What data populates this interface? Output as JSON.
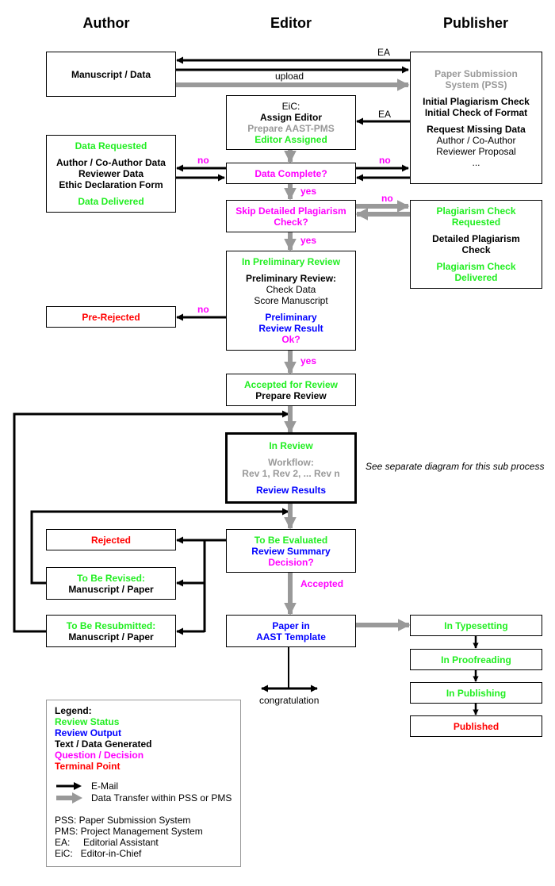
{
  "columns": {
    "author": "Author",
    "editor": "Editor",
    "publisher": "Publisher"
  },
  "colors": {
    "review_status": "#00ff00",
    "review_output": "#0000ff",
    "text_data": "#000000",
    "question": "#ff00ff",
    "terminal": "#ff0000",
    "system": "#999999",
    "email_arrow": "#000000",
    "transfer_arrow": "#999999"
  },
  "boxes": {
    "manuscript": [
      {
        "t": "Manuscript / Data",
        "c": "k"
      }
    ],
    "pss": [
      {
        "t": "Paper Submission",
        "c": "gr"
      },
      {
        "t": "System (PSS)",
        "c": "gr"
      },
      {
        "t": "Initial Plagiarism Check",
        "c": "k",
        "gap": true
      },
      {
        "t": "Initial Check of Format",
        "c": "k"
      },
      {
        "t": "Request Missing Data",
        "c": "k",
        "gap": true
      },
      {
        "t": "Author / Co-Author",
        "c": "n"
      },
      {
        "t": "Reviewer Proposal",
        "c": "n"
      },
      {
        "t": "...",
        "c": "n"
      }
    ],
    "eic": [
      {
        "t": "EiC:",
        "c": "n"
      },
      {
        "t": "Assign Editor",
        "c": "k"
      },
      {
        "t": "Prepare AAST-PMS",
        "c": "gr"
      },
      {
        "t": "Editor Assigned",
        "c": "g"
      }
    ],
    "data_requested": [
      {
        "t": "Data Requested",
        "c": "g"
      },
      {
        "t": "Author / Co-Author Data",
        "c": "k",
        "gap": true
      },
      {
        "t": "Reviewer Data",
        "c": "k"
      },
      {
        "t": "Ethic Declaration Form",
        "c": "k"
      },
      {
        "t": "Data Delivered",
        "c": "g",
        "gap": true
      }
    ],
    "data_complete": [
      {
        "t": "Data Complete?",
        "c": "m"
      }
    ],
    "skip_plagiarism": [
      {
        "t": "Skip Detailed Plagiarism",
        "c": "m"
      },
      {
        "t": "Check?",
        "c": "m"
      }
    ],
    "plagiarism": [
      {
        "t": "Plagiarism Check",
        "c": "g"
      },
      {
        "t": "Requested",
        "c": "g"
      },
      {
        "t": "Detailed Plagiarism",
        "c": "k",
        "gap": true
      },
      {
        "t": "Check",
        "c": "k"
      },
      {
        "t": "Plagiarism Check",
        "c": "g",
        "gap": true
      },
      {
        "t": "Delivered",
        "c": "g"
      }
    ],
    "preliminary": [
      {
        "t": "In Preliminary Review",
        "c": "g"
      },
      {
        "t": "Preliminary Review:",
        "c": "k",
        "gap": true
      },
      {
        "t": "Check Data",
        "c": "n"
      },
      {
        "t": "Score Manuscript",
        "c": "n"
      },
      {
        "t": "Preliminary",
        "c": "b",
        "gap": true
      },
      {
        "t": "Review Result",
        "c": "b"
      },
      {
        "t": "Ok?",
        "c": "m"
      }
    ],
    "pre_rejected": [
      {
        "t": "Pre-Rejected",
        "c": "r"
      }
    ],
    "accepted_for_review": [
      {
        "t": "Accepted for Review",
        "c": "g"
      },
      {
        "t": "Prepare Review",
        "c": "k"
      }
    ],
    "in_review": [
      {
        "t": "In Review",
        "c": "g"
      },
      {
        "t": "Workflow:",
        "c": "gr",
        "gap": true
      },
      {
        "t": "Rev 1, Rev 2, ... Rev n",
        "c": "gr"
      },
      {
        "t": "Review Results",
        "c": "b",
        "gap": true
      }
    ],
    "to_be_evaluated": [
      {
        "t": "To Be Evaluated",
        "c": "g"
      },
      {
        "t": "Review Summary",
        "c": "b"
      },
      {
        "t": "Decision?",
        "c": "m"
      }
    ],
    "rejected": [
      {
        "t": "Rejected",
        "c": "r"
      }
    ],
    "to_be_revised": [
      {
        "t": "To Be Revised:",
        "c": "g"
      },
      {
        "t": "Manuscript / Paper",
        "c": "k"
      }
    ],
    "to_be_resubmitted": [
      {
        "t": "To Be Resubmitted:",
        "c": "g"
      },
      {
        "t": "Manuscript / Paper",
        "c": "k"
      }
    ],
    "paper_in_template": [
      {
        "t": "Paper in",
        "c": "b"
      },
      {
        "t": "AAST Template",
        "c": "b"
      }
    ],
    "in_typesetting": [
      {
        "t": "In Typesetting",
        "c": "g"
      }
    ],
    "in_proofreading": [
      {
        "t": "In Proofreading",
        "c": "g"
      }
    ],
    "in_publishing": [
      {
        "t": "In Publishing",
        "c": "g"
      }
    ],
    "published": [
      {
        "t": "Published",
        "c": "r"
      }
    ]
  },
  "labels": {
    "ea_top": "EA",
    "upload": "upload",
    "ea_mid": "EA",
    "no_left": "no",
    "no_right": "no",
    "yes_1": "yes",
    "no_plag": "no",
    "yes_2": "yes",
    "no_prelim": "no",
    "yes_3": "yes",
    "accepted": "Accepted",
    "congratulation": "congratulation"
  },
  "sub_process_note": "See separate diagram for this sub process",
  "legend": {
    "title": "Legend:",
    "review_status": "Review Status",
    "review_output": "Review Output",
    "text_data": "Text / Data Generated",
    "question": "Question / Decision",
    "terminal": "Terminal Point",
    "email": "E-Mail",
    "transfer": "Data Transfer within PSS or PMS",
    "abbreviations": [
      "PSS: Paper Submission System",
      "PMS: Project Management System",
      "EA:     Editorial Assistant",
      "EiC:   Editor-in-Chief"
    ]
  }
}
